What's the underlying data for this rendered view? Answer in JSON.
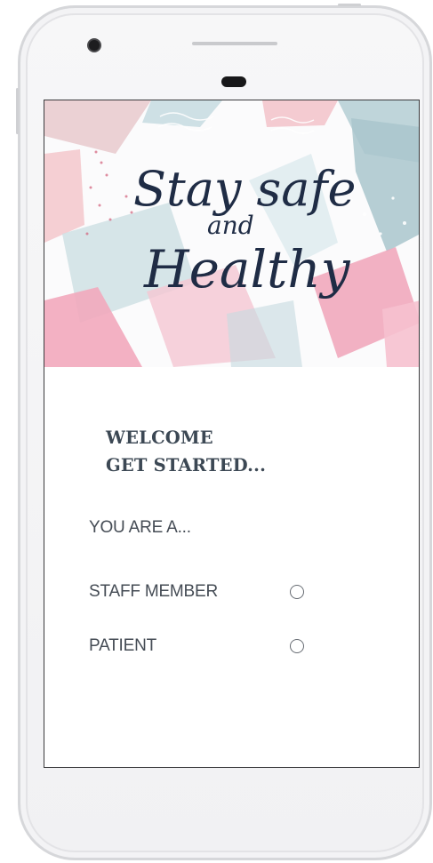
{
  "banner": {
    "line1": "Stay safe",
    "line2": "and",
    "line3": "Healthy"
  },
  "welcome": {
    "line1": "WELCOME",
    "line2": "GET STARTED..."
  },
  "role_question": "YOU ARE A...",
  "options": [
    {
      "label": "STAFF MEMBER",
      "selected": false
    },
    {
      "label": "PATIENT",
      "selected": false
    }
  ],
  "colors": {
    "heading": "#3c4854",
    "body_text": "#454c55",
    "script_ink": "#1f2c45",
    "accent_pink": "#f3b1c2",
    "accent_blue": "#bcd5dc"
  }
}
